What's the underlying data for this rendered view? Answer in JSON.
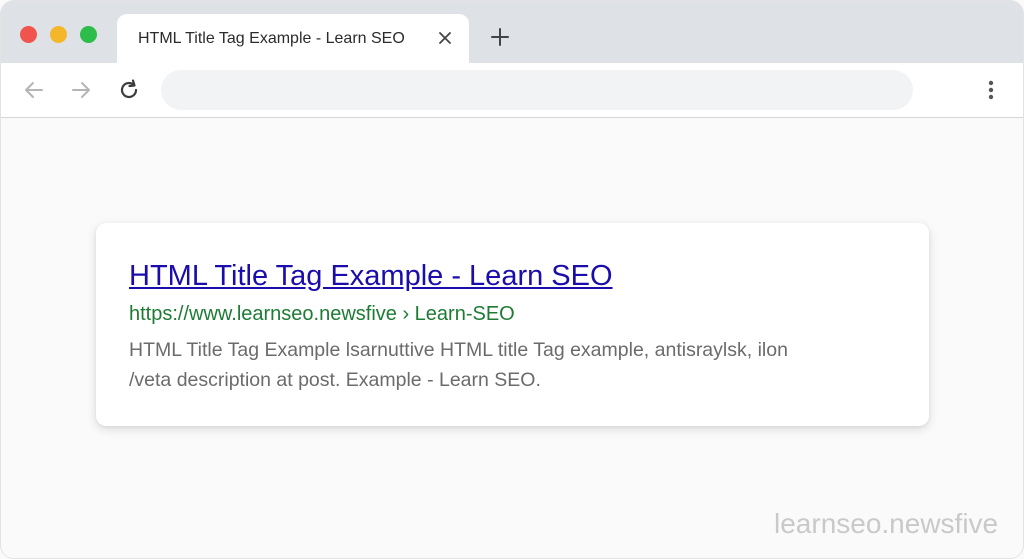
{
  "tab": {
    "title": "HTML Title Tag Example - Learn SEO",
    "close_icon": "close-icon",
    "new_tab_icon": "plus-icon"
  },
  "toolbar": {
    "back_icon": "arrow-left-icon",
    "forward_icon": "arrow-right-icon",
    "reload_icon": "reload-icon",
    "address_value": "",
    "menu_icon": "more-vertical-icon"
  },
  "result": {
    "title": "HTML Title Tag Example - Learn SEO",
    "url": "https://www.learnseo.newsfive › Learn-SEO",
    "description_line1": "HTML Title Tag Example lsarnuttive HTML title Tag example, antisraylsk, ilon",
    "description_line2": "/veta description at post. Example - Learn SEO."
  },
  "watermark": "learnseo.newsfive",
  "colors": {
    "link": "#1a0dab",
    "url": "#1e7b34",
    "snippet": "#6b6b6b",
    "traffic_red": "#f1544d",
    "traffic_yellow": "#f5b72a",
    "traffic_green": "#2dbd4a"
  }
}
